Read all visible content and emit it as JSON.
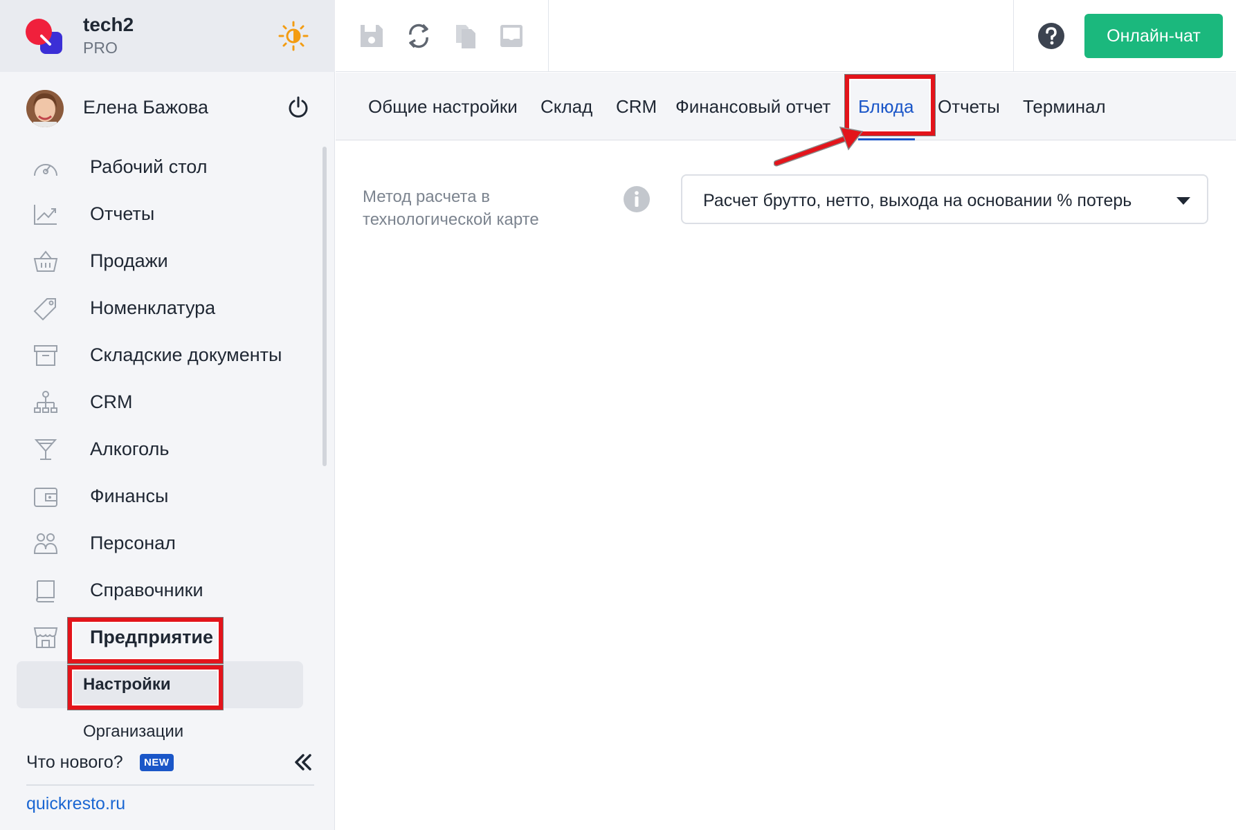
{
  "brand": {
    "name": "tech2",
    "plan": "PRO"
  },
  "user": {
    "name": "Елена Бажова"
  },
  "sidebar": {
    "items": [
      {
        "label": "Рабочий стол",
        "icon": "speedometer-icon"
      },
      {
        "label": "Отчеты",
        "icon": "chart-icon"
      },
      {
        "label": "Продажи",
        "icon": "basket-icon"
      },
      {
        "label": "Номенклатура",
        "icon": "tag-icon"
      },
      {
        "label": "Складские документы",
        "icon": "archive-icon"
      },
      {
        "label": "CRM",
        "icon": "hierarchy-icon"
      },
      {
        "label": "Алкоголь",
        "icon": "cocktail-icon"
      },
      {
        "label": "Финансы",
        "icon": "wallet-icon"
      },
      {
        "label": "Персонал",
        "icon": "people-icon"
      },
      {
        "label": "Справочники",
        "icon": "book-icon"
      },
      {
        "label": "Предприятие",
        "icon": "store-icon"
      }
    ],
    "subitems": [
      {
        "label": "Настройки",
        "active": true
      },
      {
        "label": "Организации",
        "active": false
      }
    ],
    "whats_new": "Что нового?",
    "new_badge": "NEW",
    "site_link": "quickresto.ru"
  },
  "topbar": {
    "chat_label": "Онлайн-чат",
    "icons": [
      "save-icon",
      "refresh-icon",
      "copy-icon",
      "inbox-icon",
      "help-icon"
    ]
  },
  "tabs": [
    {
      "label": "Общие настройки",
      "active": false
    },
    {
      "label": "Склад",
      "active": false
    },
    {
      "label": "CRM",
      "active": false
    },
    {
      "label": "Финансовый отчет",
      "active": false
    },
    {
      "label": "Блюда",
      "active": true
    },
    {
      "label": "Отчеты",
      "active": false
    },
    {
      "label": "Терминал",
      "active": false
    }
  ],
  "form": {
    "calc_method_label": "Метод расчета в технологической карте",
    "calc_method_value": "Расчет брутто, нетто, выхода на основании % потерь"
  },
  "colors": {
    "accent_blue": "#1a56c8",
    "chat_green": "#1bb87d",
    "highlight_red": "#e3141b",
    "theme_sun": "#f39c12"
  }
}
